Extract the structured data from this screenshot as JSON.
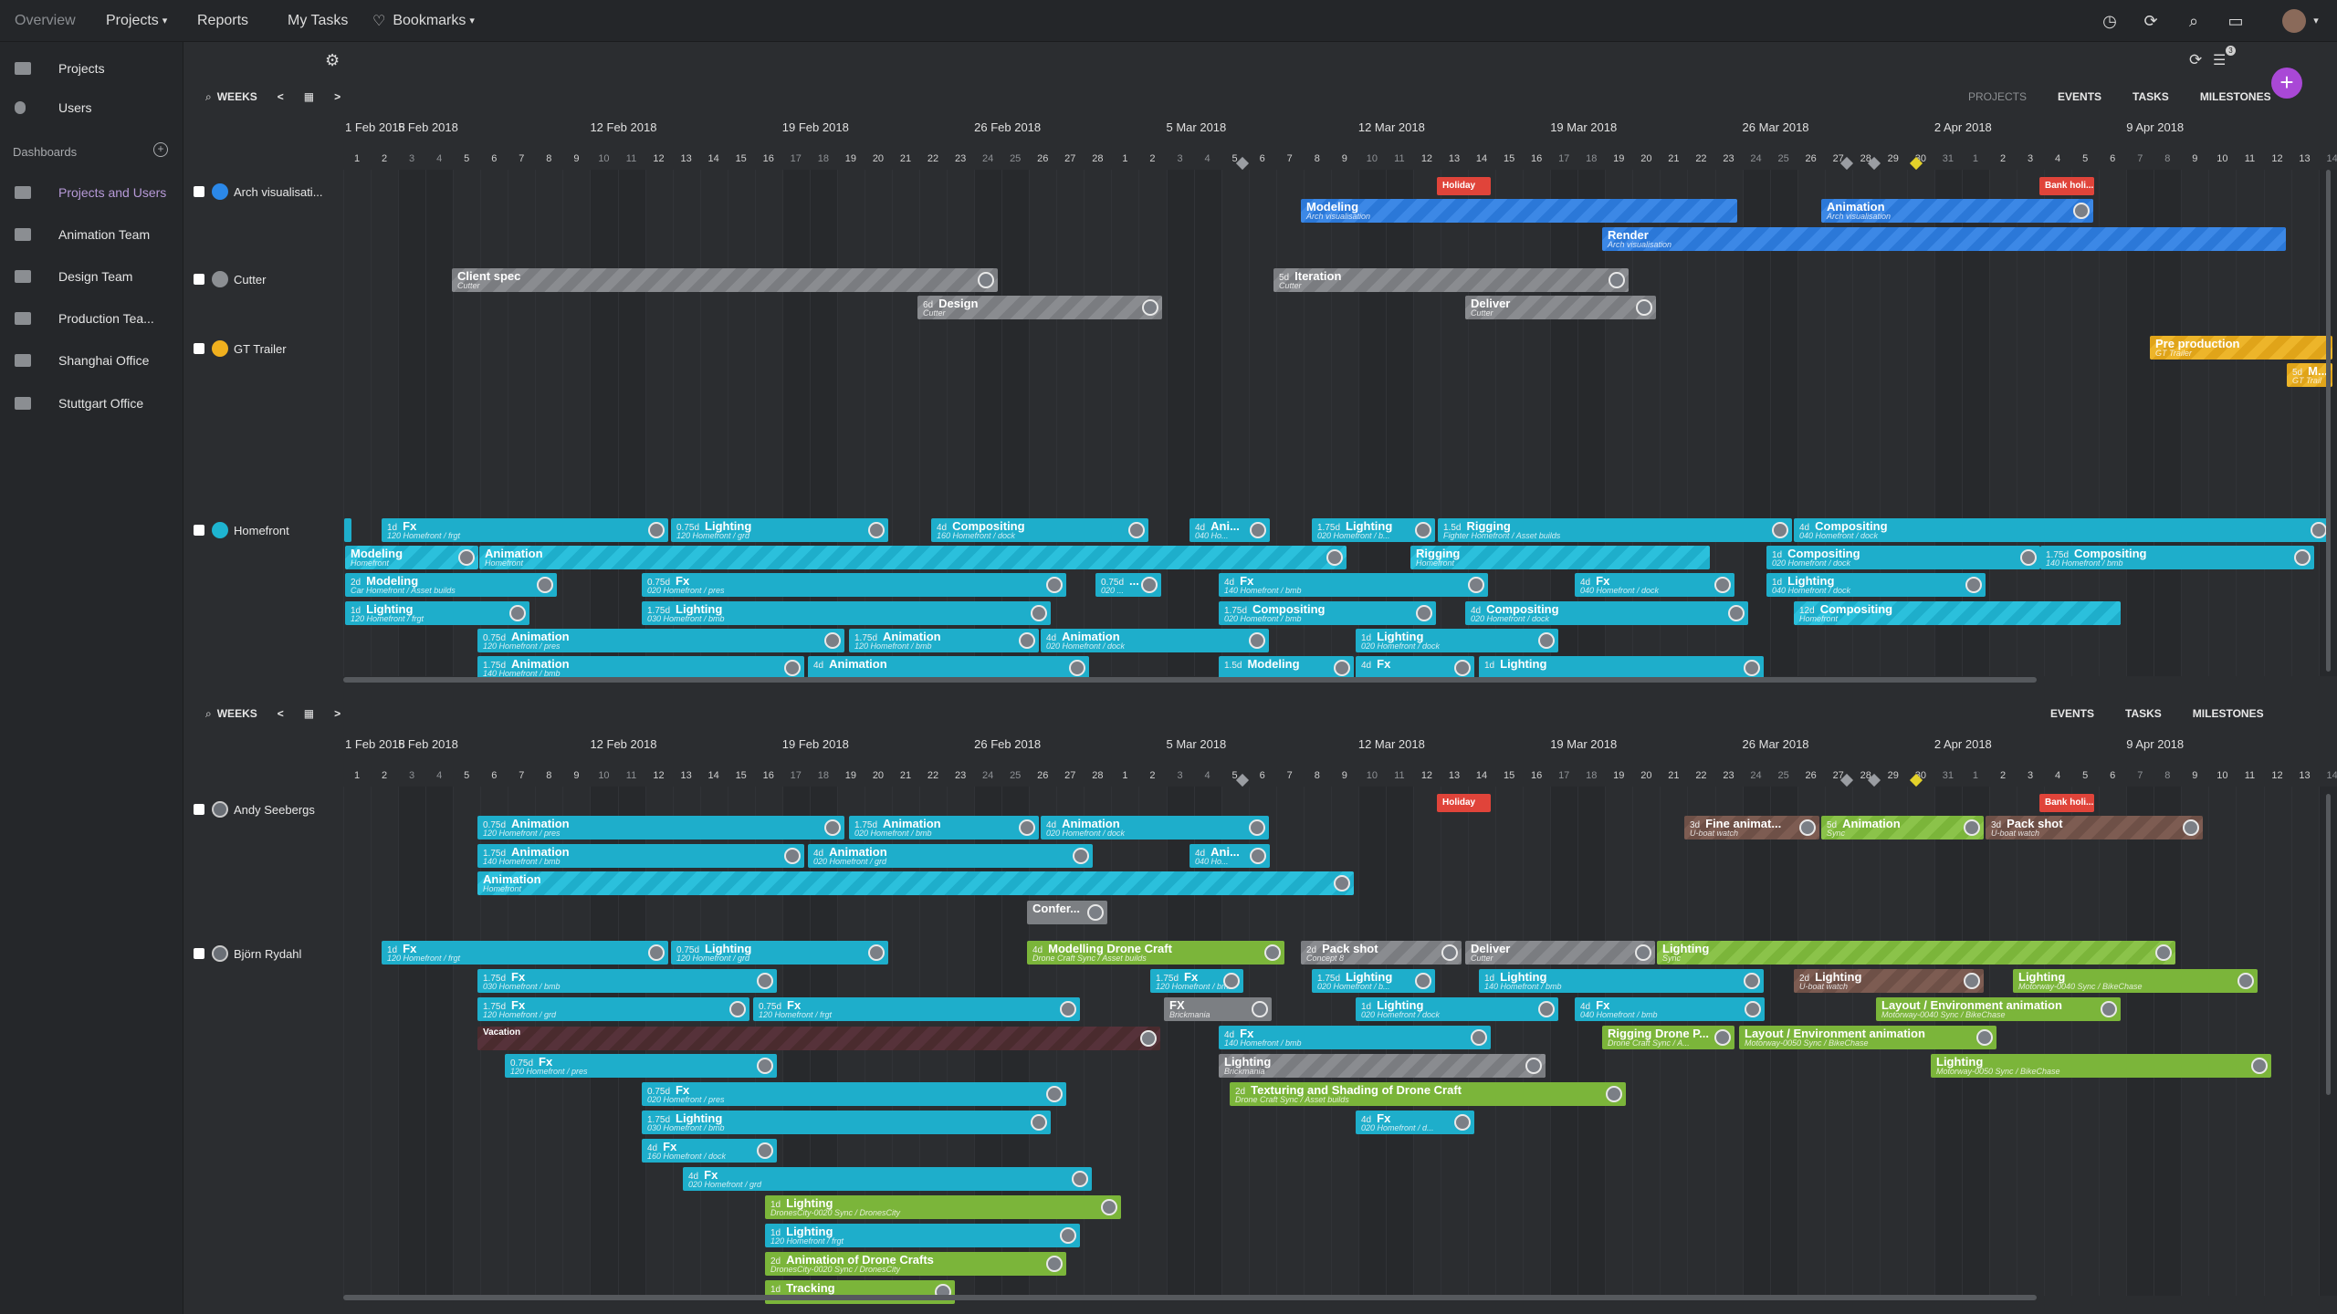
{
  "topnav": {
    "overview": "Overview",
    "projects": "Projects",
    "reports": "Reports",
    "my_tasks": "My Tasks",
    "bookmarks": "Bookmarks"
  },
  "sidebar": {
    "items": [
      {
        "label": "Projects"
      },
      {
        "label": "Users"
      }
    ],
    "dashboards_title": "Dashboards",
    "dashboards": [
      {
        "label": "Projects and Users"
      },
      {
        "label": "Animation Team"
      },
      {
        "label": "Design Team"
      },
      {
        "label": "Production Tea..."
      },
      {
        "label": "Shanghai Office"
      },
      {
        "label": "Stuttgart Office"
      }
    ]
  },
  "toolbar": {
    "weeks": "WEEKS",
    "prev": "<",
    "next": ">"
  },
  "tabs_top": {
    "projects": "PROJECTS",
    "events": "EVENTS",
    "tasks": "TASKS",
    "milestones": "MILESTONES"
  },
  "tabs_bottom": {
    "events": "EVENTS",
    "tasks": "TASKS",
    "milestones": "MILESTONES"
  },
  "notif_count": "3",
  "weeks": [
    "1 Feb 2018",
    "5 Feb 2018",
    "12 Feb 2018",
    "19 Feb 2018",
    "26 Feb 2018",
    "5 Mar 2018",
    "12 Mar 2018",
    "19 Mar 2018",
    "26 Mar 2018",
    "2 Apr 2018",
    "9 Apr 2018"
  ],
  "days": [
    "1",
    "2",
    "3",
    "4",
    "5",
    "6",
    "7",
    "8",
    "9",
    "10",
    "11",
    "12",
    "13",
    "14",
    "15",
    "16",
    "17",
    "18",
    "19",
    "20",
    "21",
    "22",
    "23",
    "24",
    "25",
    "26",
    "27",
    "28",
    "1",
    "2",
    "3",
    "4",
    "5",
    "6",
    "7",
    "8",
    "9",
    "10",
    "11",
    "12",
    "13",
    "14",
    "15",
    "16",
    "17",
    "18",
    "19",
    "20",
    "21",
    "22",
    "23",
    "24",
    "25",
    "26",
    "27",
    "28",
    "29",
    "30",
    "31",
    "1",
    "2",
    "3",
    "4",
    "5",
    "6",
    "7",
    "8",
    "9",
    "10",
    "11",
    "12",
    "13",
    "14"
  ],
  "projects": [
    {
      "name": "Arch visualisati...",
      "color": "#2b88e8"
    },
    {
      "name": "Cutter",
      "color": "#8c8f93"
    },
    {
      "name": "GT Trailer",
      "color": "#f0b01e"
    },
    {
      "name": "Homefront",
      "color": "#1eb4d0"
    }
  ],
  "users": [
    {
      "name": "Andy Seebergs"
    },
    {
      "name": "Björn Rydahl"
    }
  ],
  "colors": {
    "cyan": "#1eaecb",
    "blue": "#2b78d8",
    "green": "#7bb53a",
    "gold": "#e0a419",
    "red": "#e0443a",
    "accent": "#a948d6"
  },
  "bars_top": [
    {
      "cls": "red",
      "l": 1574,
      "t": 194,
      "w": 59,
      "h": 20,
      "title": "Holiday",
      "sub": "",
      "dur": "",
      "av": false
    },
    {
      "cls": "red",
      "l": 2234,
      "t": 194,
      "w": 60,
      "h": 20,
      "title": "Bank holi...",
      "sub": "",
      "dur": "",
      "av": false
    },
    {
      "cls": "blue",
      "l": 1425,
      "t": 218,
      "w": 478,
      "title": "Modeling",
      "sub": "Arch visualisation",
      "dur": "",
      "av": false
    },
    {
      "cls": "blue",
      "l": 1995,
      "t": 218,
      "w": 298,
      "title": "Animation",
      "sub": "Arch visualisation",
      "dur": "",
      "av": true
    },
    {
      "cls": "blue",
      "l": 1755,
      "t": 249,
      "w": 749,
      "title": "Render",
      "sub": "Arch visualisation",
      "dur": "",
      "av": false
    },
    {
      "cls": "gray",
      "l": 495,
      "t": 294,
      "w": 598,
      "title": "Client spec",
      "sub": "Cutter",
      "dur": "",
      "av": true
    },
    {
      "cls": "gray",
      "l": 1395,
      "t": 294,
      "w": 389,
      "title": "Iteration",
      "sub": "Cutter",
      "dur": "5d",
      "av": true
    },
    {
      "cls": "gray",
      "l": 1005,
      "t": 324,
      "w": 268,
      "title": "Design",
      "sub": "Cutter",
      "dur": "6d",
      "av": true
    },
    {
      "cls": "gray",
      "l": 1605,
      "t": 324,
      "w": 209,
      "title": "Deliver",
      "sub": "Cutter",
      "dur": "",
      "av": true
    },
    {
      "cls": "gold",
      "l": 2355,
      "t": 368,
      "w": 200,
      "title": "Pre production",
      "sub": "GT Trailer",
      "dur": "",
      "av": false
    },
    {
      "cls": "gold",
      "l": 2505,
      "t": 398,
      "w": 50,
      "title": "M...",
      "sub": "GT Trail",
      "dur": "5d",
      "av": false
    },
    {
      "cls": "cyan",
      "l": 377,
      "t": 568,
      "w": 8,
      "title": "",
      "sub": "",
      "dur": "",
      "av": false
    },
    {
      "cls": "cyan",
      "l": 418,
      "t": 568,
      "w": 314,
      "title": "Fx",
      "sub": "120    Homefront / frgt",
      "dur": "1d",
      "av": true
    },
    {
      "cls": "cyan",
      "l": 735,
      "t": 568,
      "w": 238,
      "title": "Lighting",
      "sub": "120    Homefront / grd",
      "dur": "0.75d",
      "av": true
    },
    {
      "cls": "cyan",
      "l": 1020,
      "t": 568,
      "w": 238,
      "title": "Compositing",
      "sub": "160    Homefront / dock",
      "dur": "4d",
      "av": true
    },
    {
      "cls": "cyan",
      "l": 1303,
      "t": 568,
      "w": 88,
      "title": "Ani...",
      "sub": "040    Ho...",
      "dur": "4d",
      "av": true
    },
    {
      "cls": "cyan",
      "l": 1437,
      "t": 568,
      "w": 135,
      "title": "Lighting",
      "sub": "020    Homefront / b...",
      "dur": "1.75d",
      "av": true
    },
    {
      "cls": "cyan",
      "l": 1575,
      "t": 568,
      "w": 388,
      "title": "Rigging",
      "sub": "Fighter    Homefront / Asset builds",
      "dur": "1.5d",
      "av": true
    },
    {
      "cls": "cyan",
      "l": 1965,
      "t": 568,
      "w": 588,
      "title": "Compositing",
      "sub": "040    Homefront / dock",
      "dur": "4d",
      "av": true
    },
    {
      "cls": "cyan stripe",
      "l": 378,
      "t": 598,
      "w": 146,
      "title": "Modeling",
      "sub": "Homefront",
      "dur": "",
      "av": true
    },
    {
      "cls": "cyan stripe",
      "l": 525,
      "t": 598,
      "w": 950,
      "title": "Animation",
      "sub": "Homefront",
      "dur": "",
      "av": true
    },
    {
      "cls": "cyan stripe",
      "l": 1545,
      "t": 598,
      "w": 328,
      "title": "Rigging",
      "sub": "Homefront",
      "dur": "",
      "av": false
    },
    {
      "cls": "cyan",
      "l": 1935,
      "t": 598,
      "w": 300,
      "title": "Compositing",
      "sub": "020    Homefront / dock",
      "dur": "1d",
      "av": true
    },
    {
      "cls": "cyan",
      "l": 2235,
      "t": 598,
      "w": 300,
      "title": "Compositing",
      "sub": "140    Homefront / bmb",
      "dur": "1.75d",
      "av": true
    },
    {
      "cls": "cyan",
      "l": 378,
      "t": 628,
      "w": 232,
      "title": "Modeling",
      "sub": "Car    Homefront / Asset builds",
      "dur": "2d",
      "av": true
    },
    {
      "cls": "cyan",
      "l": 703,
      "t": 628,
      "w": 465,
      "title": "Fx",
      "sub": "020    Homefront / pres",
      "dur": "0.75d",
      "av": true
    },
    {
      "cls": "cyan",
      "l": 1200,
      "t": 628,
      "w": 72,
      "title": "...",
      "sub": "020    ...",
      "dur": "0.75d",
      "av": true
    },
    {
      "cls": "cyan",
      "l": 1335,
      "t": 628,
      "w": 295,
      "title": "Fx",
      "sub": "140    Homefront / bmb",
      "dur": "4d",
      "av": true
    },
    {
      "cls": "cyan",
      "l": 1725,
      "t": 628,
      "w": 175,
      "title": "Fx",
      "sub": "040    Homefront / dock",
      "dur": "4d",
      "av": true
    },
    {
      "cls": "cyan",
      "l": 1935,
      "t": 628,
      "w": 240,
      "title": "Lighting",
      "sub": "040    Homefront / dock",
      "dur": "1d",
      "av": true
    },
    {
      "cls": "cyan",
      "l": 378,
      "t": 659,
      "w": 202,
      "title": "Lighting",
      "sub": "120    Homefront / frgt",
      "dur": "1d",
      "av": true
    },
    {
      "cls": "cyan",
      "l": 703,
      "t": 659,
      "w": 448,
      "title": "Lighting",
      "sub": "030    Homefront / bmb",
      "dur": "1.75d",
      "av": true
    },
    {
      "cls": "cyan",
      "l": 1335,
      "t": 659,
      "w": 238,
      "title": "Compositing",
      "sub": "020    Homefront / bmb",
      "dur": "1.75d",
      "av": true
    },
    {
      "cls": "cyan",
      "l": 1605,
      "t": 659,
      "w": 310,
      "title": "Compositing",
      "sub": "020    Homefront / dock",
      "dur": "4d",
      "av": true
    },
    {
      "cls": "cyan stripe",
      "l": 1965,
      "t": 659,
      "w": 358,
      "title": "Compositing",
      "sub": "Homefront",
      "dur": "12d",
      "av": false
    },
    {
      "cls": "cyan",
      "l": 523,
      "t": 689,
      "w": 402,
      "title": "Animation",
      "sub": "120    Homefront / pres",
      "dur": "0.75d",
      "av": true
    },
    {
      "cls": "cyan",
      "l": 930,
      "t": 689,
      "w": 208,
      "title": "Animation",
      "sub": "120    Homefront / bmb",
      "dur": "1.75d",
      "av": true
    },
    {
      "cls": "cyan",
      "l": 1140,
      "t": 689,
      "w": 250,
      "title": "Animation",
      "sub": "020    Homefront / dock",
      "dur": "4d",
      "av": true
    },
    {
      "cls": "cyan",
      "l": 1485,
      "t": 689,
      "w": 222,
      "title": "Lighting",
      "sub": "020    Homefront / dock",
      "dur": "1d",
      "av": true
    },
    {
      "cls": "cyan",
      "l": 523,
      "t": 719,
      "w": 358,
      "title": "Animation",
      "sub": "140    Homefront / bmb",
      "dur": "1.75d",
      "av": true
    },
    {
      "cls": "cyan",
      "l": 885,
      "t": 719,
      "w": 308,
      "title": "Animation",
      "sub": "",
      "dur": "4d",
      "av": true
    },
    {
      "cls": "cyan",
      "l": 1335,
      "t": 719,
      "w": 148,
      "title": "Modeling",
      "sub": "",
      "dur": "1.5d",
      "av": true
    },
    {
      "cls": "cyan",
      "l": 1485,
      "t": 719,
      "w": 130,
      "title": "Fx",
      "sub": "",
      "dur": "4d",
      "av": true
    },
    {
      "cls": "cyan",
      "l": 1620,
      "t": 719,
      "w": 312,
      "title": "Lighting",
      "sub": "",
      "dur": "1d",
      "av": true
    }
  ],
  "bars_bottom": [
    {
      "cls": "red",
      "l": 1574,
      "t": 870,
      "w": 59,
      "h": 20,
      "title": "Holiday",
      "sub": "",
      "dur": "",
      "av": false
    },
    {
      "cls": "red",
      "l": 2234,
      "t": 870,
      "w": 60,
      "h": 20,
      "title": "Bank holi...",
      "sub": "",
      "dur": "",
      "av": false
    },
    {
      "cls": "cyan",
      "l": 523,
      "t": 894,
      "w": 402,
      "title": "Animation",
      "sub": "120    Homefront / pres",
      "dur": "0.75d",
      "av": true
    },
    {
      "cls": "cyan",
      "l": 930,
      "t": 894,
      "w": 208,
      "title": "Animation",
      "sub": "020    Homefront / bmb",
      "dur": "1.75d",
      "av": true
    },
    {
      "cls": "cyan",
      "l": 1140,
      "t": 894,
      "w": 250,
      "title": "Animation",
      "sub": "020    Homefront / dock",
      "dur": "4d",
      "av": true
    },
    {
      "cls": "brown",
      "l": 1845,
      "t": 894,
      "w": 148,
      "title": "Fine animat...",
      "sub": "U-boat watch",
      "dur": "3d",
      "av": true
    },
    {
      "cls": "green stripe",
      "l": 1995,
      "t": 894,
      "w": 178,
      "title": "Animation",
      "sub": "Sync",
      "dur": "5d",
      "av": true
    },
    {
      "cls": "brown",
      "l": 2175,
      "t": 894,
      "w": 238,
      "title": "Pack shot",
      "sub": "U-boat watch",
      "dur": "3d",
      "av": true
    },
    {
      "cls": "cyan",
      "l": 523,
      "t": 925,
      "w": 358,
      "title": "Animation",
      "sub": "140    Homefront / bmb",
      "dur": "1.75d",
      "av": true
    },
    {
      "cls": "cyan",
      "l": 885,
      "t": 925,
      "w": 312,
      "title": "Animation",
      "sub": "020    Homefront / grd",
      "dur": "4d",
      "av": true
    },
    {
      "cls": "cyan",
      "l": 1303,
      "t": 925,
      "w": 88,
      "title": "Ani...",
      "sub": "040    Ho...",
      "dur": "4d",
      "av": true
    },
    {
      "cls": "cyan stripe",
      "l": 523,
      "t": 955,
      "w": 960,
      "title": "Animation",
      "sub": "Homefront",
      "dur": "",
      "av": true
    },
    {
      "cls": "gray solid",
      "l": 1125,
      "t": 987,
      "w": 88,
      "title": "Confer...",
      "sub": "",
      "dur": "",
      "av": true
    },
    {
      "cls": "cyan",
      "l": 418,
      "t": 1031,
      "w": 314,
      "title": "Fx",
      "sub": "120    Homefront / frgt",
      "dur": "1d",
      "av": true
    },
    {
      "cls": "cyan",
      "l": 735,
      "t": 1031,
      "w": 238,
      "title": "Lighting",
      "sub": "120    Homefront / grd",
      "dur": "0.75d",
      "av": true
    },
    {
      "cls": "green",
      "l": 1125,
      "t": 1031,
      "w": 282,
      "title": "Modelling Drone Craft",
      "sub": "Drone Craft    Sync / Asset builds",
      "dur": "4d",
      "av": true
    },
    {
      "cls": "gray",
      "l": 1425,
      "t": 1031,
      "w": 176,
      "title": "Pack shot",
      "sub": "Concept 8",
      "dur": "2d",
      "av": true
    },
    {
      "cls": "gray",
      "l": 1605,
      "t": 1031,
      "w": 208,
      "title": "Deliver",
      "sub": "Cutter",
      "dur": "",
      "av": true
    },
    {
      "cls": "green stripe",
      "l": 1815,
      "t": 1031,
      "w": 568,
      "title": "Lighting",
      "sub": "Sync",
      "dur": "",
      "av": true
    },
    {
      "cls": "cyan",
      "l": 523,
      "t": 1062,
      "w": 328,
      "title": "Fx",
      "sub": "030    Homefront / bmb",
      "dur": "1.75d",
      "av": true
    },
    {
      "cls": "cyan",
      "l": 1260,
      "t": 1062,
      "w": 102,
      "title": "Fx",
      "sub": "120    Homefront / bmb",
      "dur": "1.75d",
      "av": true
    },
    {
      "cls": "cyan",
      "l": 1437,
      "t": 1062,
      "w": 135,
      "title": "Lighting",
      "sub": "020    Homefront / b...",
      "dur": "1.75d",
      "av": true
    },
    {
      "cls": "cyan",
      "l": 1620,
      "t": 1062,
      "w": 312,
      "title": "Lighting",
      "sub": "140    Homefront / bmb",
      "dur": "1d",
      "av": true
    },
    {
      "cls": "brown",
      "l": 1965,
      "t": 1062,
      "w": 208,
      "title": "Lighting",
      "sub": "U-boat watch",
      "dur": "2d",
      "av": true
    },
    {
      "cls": "green",
      "l": 2205,
      "t": 1062,
      "w": 268,
      "title": "Lighting",
      "sub": "Motorway-0040    Sync / BikeChase",
      "dur": "",
      "av": true
    },
    {
      "cls": "cyan",
      "l": 523,
      "t": 1093,
      "w": 298,
      "title": "Fx",
      "sub": "120    Homefront / grd",
      "dur": "1.75d",
      "av": true
    },
    {
      "cls": "cyan",
      "l": 825,
      "t": 1093,
      "w": 358,
      "title": "Fx",
      "sub": "120    Homefront / frgt",
      "dur": "0.75d",
      "av": true
    },
    {
      "cls": "gray solid",
      "l": 1275,
      "t": 1093,
      "w": 118,
      "title": "FX",
      "sub": "Brickmania",
      "dur": "",
      "av": true
    },
    {
      "cls": "cyan",
      "l": 1485,
      "t": 1093,
      "w": 222,
      "title": "Lighting",
      "sub": "020    Homefront / dock",
      "dur": "1d",
      "av": true
    },
    {
      "cls": "cyan",
      "l": 1725,
      "t": 1093,
      "w": 208,
      "title": "Fx",
      "sub": "040    Homefront / bmb",
      "dur": "4d",
      "av": true
    },
    {
      "cls": "green",
      "l": 2055,
      "t": 1093,
      "w": 268,
      "title": "Layout / Environment animation",
      "sub": "Motorway-0040    Sync / BikeChase",
      "dur": "",
      "av": true
    },
    {
      "cls": "darkred",
      "l": 523,
      "t": 1125,
      "w": 748,
      "title": "Vacation",
      "sub": "",
      "dur": "",
      "av": true
    },
    {
      "cls": "cyan",
      "l": 1335,
      "t": 1124,
      "w": 298,
      "title": "Fx",
      "sub": "140    Homefront / bmb",
      "dur": "4d",
      "av": true
    },
    {
      "cls": "green",
      "l": 1755,
      "t": 1124,
      "w": 145,
      "title": "Rigging Drone P...",
      "sub": "Drone Craft    Sync / A...",
      "dur": "",
      "av": true
    },
    {
      "cls": "green",
      "l": 1905,
      "t": 1124,
      "w": 282,
      "title": "Layout / Environment animation",
      "sub": "Motorway-0050    Sync / BikeChase",
      "dur": "",
      "av": true
    },
    {
      "cls": "cyan",
      "l": 553,
      "t": 1155,
      "w": 298,
      "title": "Fx",
      "sub": "120    Homefront / pres",
      "dur": "0.75d",
      "av": true
    },
    {
      "cls": "gray",
      "l": 1335,
      "t": 1155,
      "w": 358,
      "title": "Lighting",
      "sub": "Brickmania",
      "dur": "",
      "av": true
    },
    {
      "cls": "green",
      "l": 2115,
      "t": 1155,
      "w": 373,
      "title": "Lighting",
      "sub": "Motorway-0050    Sync / BikeChase",
      "dur": "",
      "av": true
    },
    {
      "cls": "cyan",
      "l": 703,
      "t": 1186,
      "w": 465,
      "title": "Fx",
      "sub": "020    Homefront / pres",
      "dur": "0.75d",
      "av": true
    },
    {
      "cls": "green",
      "l": 1347,
      "t": 1186,
      "w": 434,
      "title": "Texturing and Shading of Drone Craft",
      "sub": "Drone Craft    Sync / Asset builds",
      "dur": "2d",
      "av": true
    },
    {
      "cls": "cyan",
      "l": 703,
      "t": 1217,
      "w": 448,
      "title": "Lighting",
      "sub": "030    Homefront / bmb",
      "dur": "1.75d",
      "av": true
    },
    {
      "cls": "cyan",
      "l": 1485,
      "t": 1217,
      "w": 130,
      "title": "Fx",
      "sub": "020    Homefront / d...",
      "dur": "4d",
      "av": true
    },
    {
      "cls": "cyan",
      "l": 703,
      "t": 1248,
      "w": 148,
      "title": "Fx",
      "sub": "160    Homefront / dock",
      "dur": "4d",
      "av": true
    },
    {
      "cls": "cyan",
      "l": 748,
      "t": 1279,
      "w": 448,
      "title": "Fx",
      "sub": "020    Homefront / grd",
      "dur": "4d",
      "av": true
    },
    {
      "cls": "green",
      "l": 838,
      "t": 1310,
      "w": 390,
      "title": "Lighting",
      "sub": "DronesCity-0020    Sync / DronesCity",
      "dur": "1d",
      "av": true
    },
    {
      "cls": "cyan",
      "l": 838,
      "t": 1341,
      "w": 345,
      "title": "Lighting",
      "sub": "120    Homefront / frgt",
      "dur": "1d",
      "av": true
    },
    {
      "cls": "green",
      "l": 838,
      "t": 1372,
      "w": 330,
      "title": "Animation of Drone Crafts",
      "sub": "DronesCity-0020    Sync / DronesCity",
      "dur": "2d",
      "av": true
    },
    {
      "cls": "green",
      "l": 838,
      "t": 1403,
      "w": 208,
      "title": "Tracking",
      "sub": "",
      "dur": "1d",
      "av": true
    }
  ]
}
